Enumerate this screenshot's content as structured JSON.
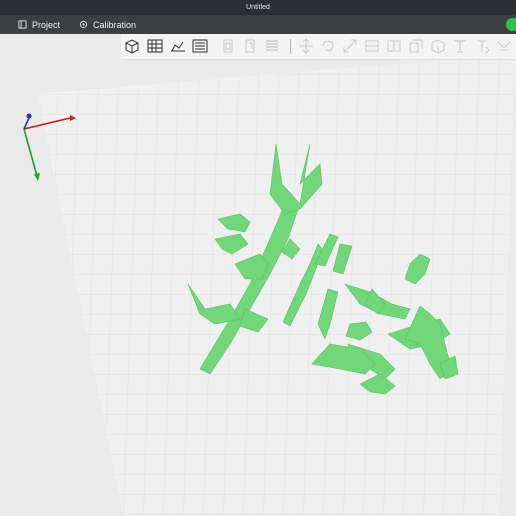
{
  "window": {
    "title": "Untitled"
  },
  "menu": {
    "project_label": "Project",
    "calibration_label": "Calibration"
  },
  "toolbar": {
    "enabled_tools": [
      "add-cube-icon",
      "grid-layout-icon",
      "scene-icon",
      "slice-layers-icon"
    ],
    "disabled_tools": [
      "copy-icon",
      "paste-icon",
      "delete-icon",
      "move-icon",
      "rotate-icon",
      "scale-icon",
      "mirror-icon",
      "cut-icon",
      "duplicate-icon",
      "place-face-icon",
      "support-icon",
      "text-icon",
      "measure-icon"
    ]
  },
  "colors": {
    "model": "#72d67a",
    "status": "#27c24c",
    "grid": "#d6d6d6",
    "bed": "#efefef"
  }
}
